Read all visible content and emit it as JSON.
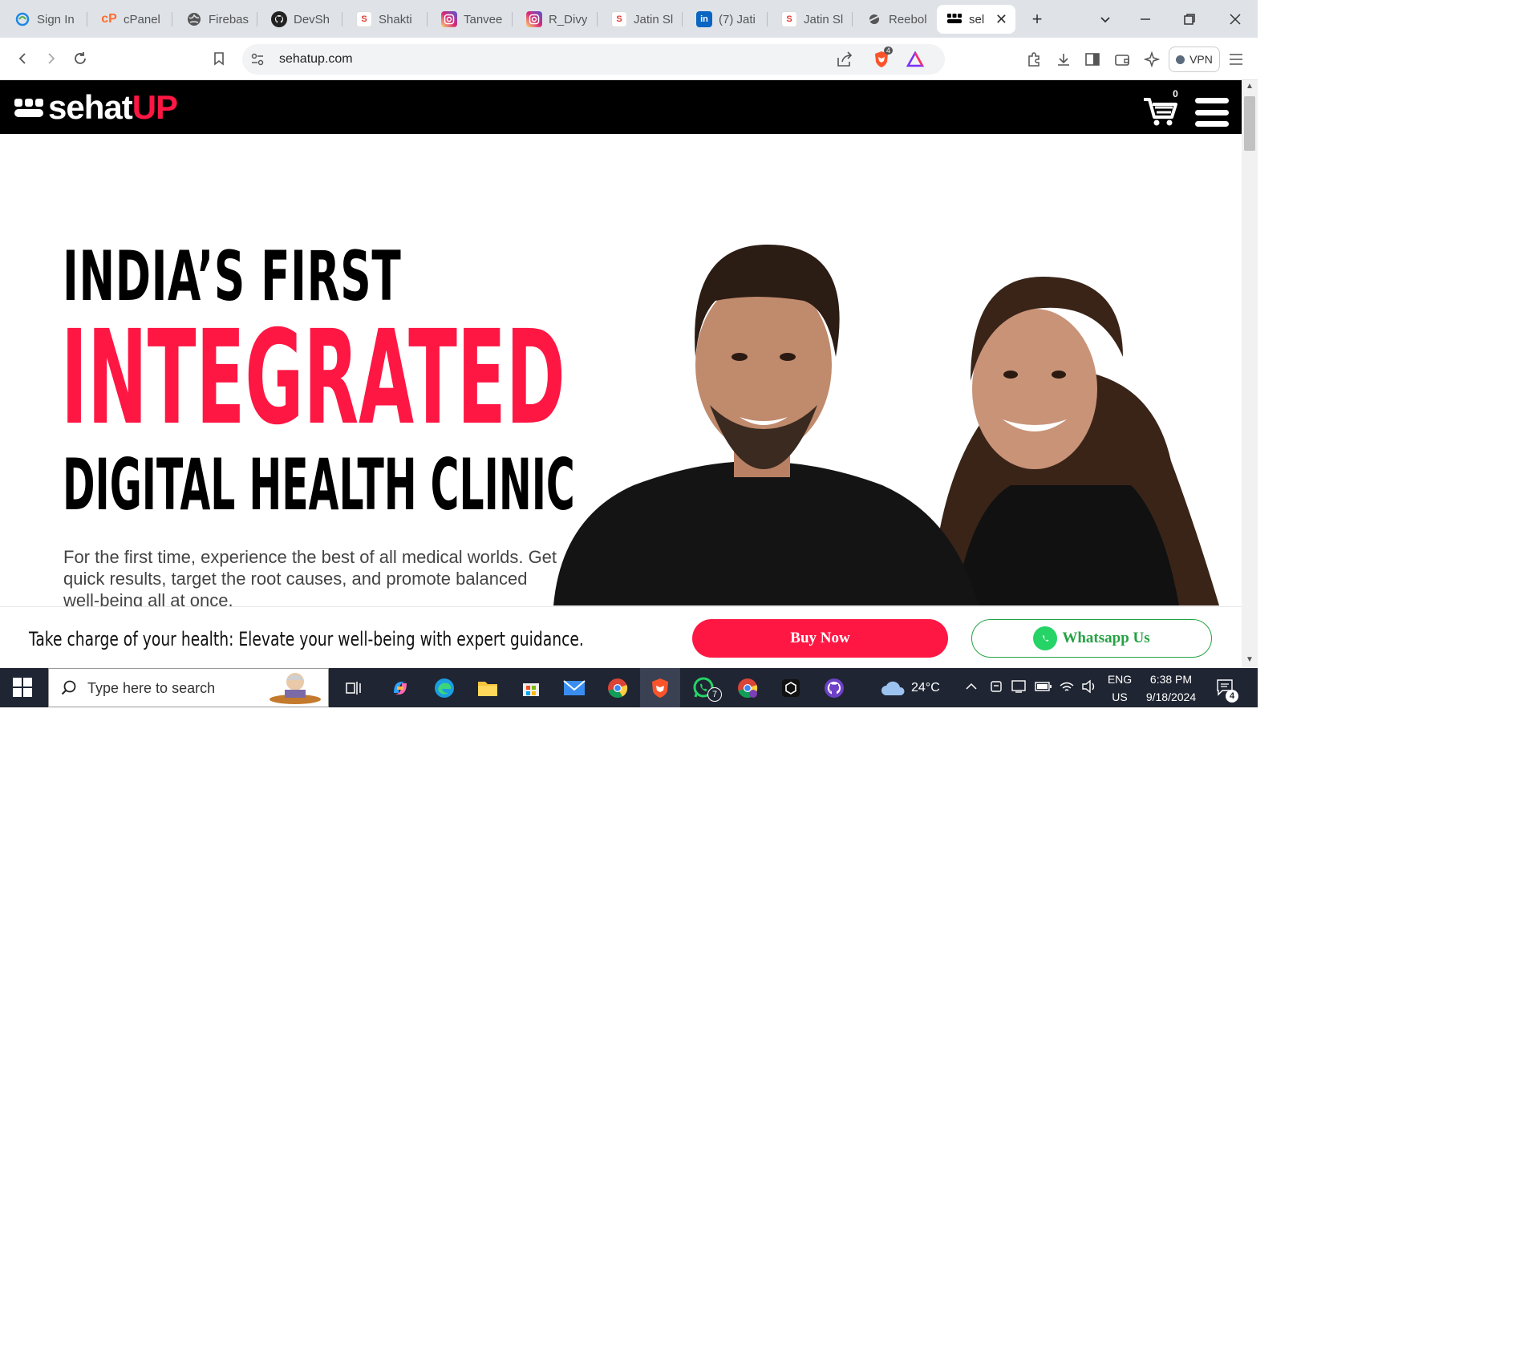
{
  "browser": {
    "tabs": [
      {
        "title": "Sign In",
        "icon": "swirl-icon",
        "color": "#1e88e5"
      },
      {
        "title": "cPanel",
        "icon": "cpanel-icon",
        "color": "#ff6c2c"
      },
      {
        "title": "Firebas",
        "icon": "globe-icon",
        "color": "#444444"
      },
      {
        "title": "DevSh",
        "icon": "github-icon",
        "color": "#222222"
      },
      {
        "title": "Shakti",
        "icon": "s-logo-icon",
        "color": "#e53935"
      },
      {
        "title": "Tanvee",
        "icon": "instagram-icon",
        "color": "#d62976"
      },
      {
        "title": "R_Divy",
        "icon": "instagram-icon",
        "color": "#d62976"
      },
      {
        "title": "Jatin Sl",
        "icon": "s-logo-icon",
        "color": "#e53935"
      },
      {
        "title": "(7) Jati",
        "icon": "linkedin-icon",
        "color": "#0a66c2"
      },
      {
        "title": "Jatin Sl",
        "icon": "s-logo-icon",
        "color": "#e53935"
      },
      {
        "title": "Reebol",
        "icon": "reebok-icon",
        "color": "#333333"
      }
    ],
    "active_tab": {
      "title": "sel",
      "close": "✕"
    },
    "new_tab": "+",
    "url": "sehatup.com",
    "brave_badge": "4",
    "vpn_label": "VPN"
  },
  "site": {
    "logo": {
      "main": "sehat",
      "accent": "UP"
    },
    "cart_count": "0",
    "hero": {
      "line1": "INDIA’S FIRST",
      "line2": "INTEGRATED",
      "line3": "DIGITAL HEALTH CLINIC",
      "description": "For the first time, experience the best of all medical worlds. Get quick results, target the root causes, and promote balanced well-being all at once."
    },
    "cta": {
      "text": "Take charge of your health: Elevate your well-being with expert guidance.",
      "buy_label": "Buy Now",
      "whatsapp_label": "Whatsapp Us"
    },
    "colors": {
      "brand": "#ff1744",
      "whatsapp": "#25a244"
    }
  },
  "taskbar": {
    "search_placeholder": "Type here to search",
    "whatsapp_badge": "7",
    "weather": "24°C",
    "lang_top": "ENG",
    "lang_bottom": "US",
    "time": "6:38 PM",
    "date": "9/18/2024",
    "notifications": "4"
  }
}
